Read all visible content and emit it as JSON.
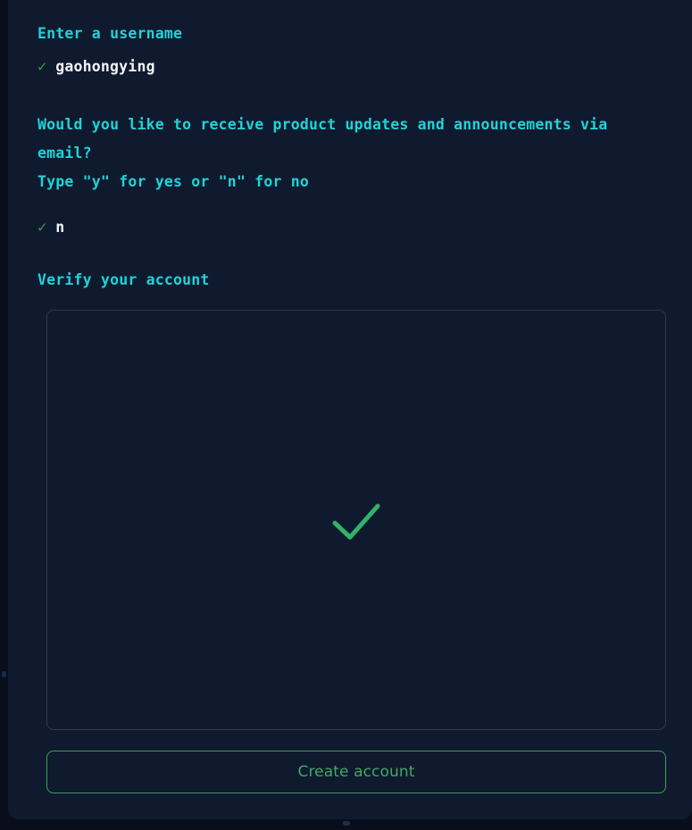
{
  "colors": {
    "page_background": "#080e1c",
    "card_background": "#101a2e",
    "prompt_text": "#1fd3d8",
    "answer_text": "#f2f5fa",
    "check_green": "#2f9e4f",
    "big_check_green": "#2fb36a",
    "button_border": "#3f9e5c",
    "button_text": "#41a862",
    "box_border": "#2c3a50",
    "strip_blue": "#0b2f74"
  },
  "steps": {
    "username": {
      "prompt": "Enter a username",
      "check_icon": "✓",
      "value": "gaohongying"
    },
    "updates": {
      "prompt": "Would you like to receive product updates and announcements via email?\nType \"y\" for yes or \"n\" for no",
      "check_icon": "✓",
      "value": "n"
    },
    "verify": {
      "prompt": "Verify your account",
      "status_icon": "verified-check"
    }
  },
  "actions": {
    "create_account_label": "Create account"
  }
}
